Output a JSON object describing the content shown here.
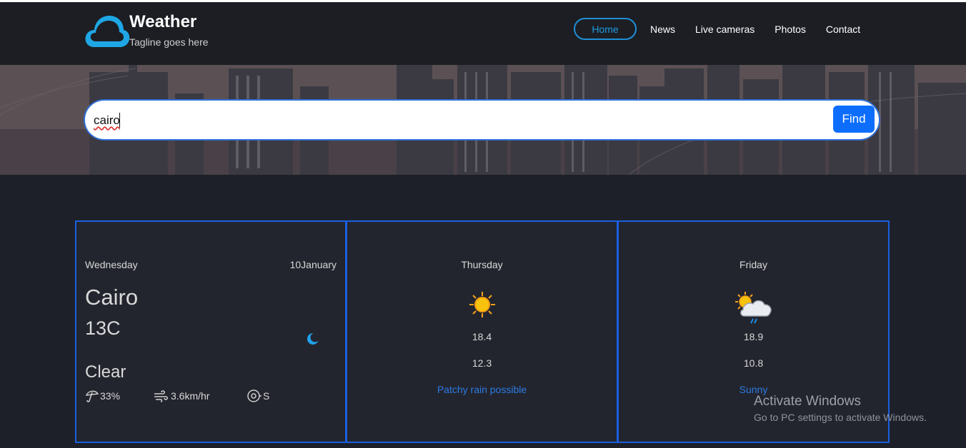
{
  "header": {
    "brand_title": "Weather",
    "brand_tagline": "Tagline goes here",
    "nav": [
      {
        "label": "Home",
        "active": true
      },
      {
        "label": "News",
        "active": false
      },
      {
        "label": "Live cameras",
        "active": false
      },
      {
        "label": "Photos",
        "active": false
      },
      {
        "label": "Contact",
        "active": false
      }
    ]
  },
  "search": {
    "value": "cairo",
    "button_label": "Find"
  },
  "today": {
    "day": "Wednesday",
    "date": "10January",
    "city": "Cairo",
    "temperature": "13C",
    "condition": "Clear",
    "condition_icon": "moon-icon",
    "humidity": "33%",
    "wind_speed": "3.6km/hr",
    "wind_direction": "S"
  },
  "forecast": [
    {
      "day": "Thursday",
      "icon": "sun-icon",
      "max": "18.4",
      "min": "12.3",
      "condition": "Patchy rain possible"
    },
    {
      "day": "Friday",
      "icon": "sun-cloud-rain-icon",
      "max": "18.9",
      "min": "10.8",
      "condition": "Sunny"
    }
  ],
  "watermark": {
    "title": "Activate Windows",
    "subtitle": "Go to PC settings to activate Windows."
  },
  "colors": {
    "accent": "#0d6efd",
    "card_border": "#1a5fe0",
    "link_blue": "#2c7be5",
    "nav_active": "#1e8fd6"
  }
}
